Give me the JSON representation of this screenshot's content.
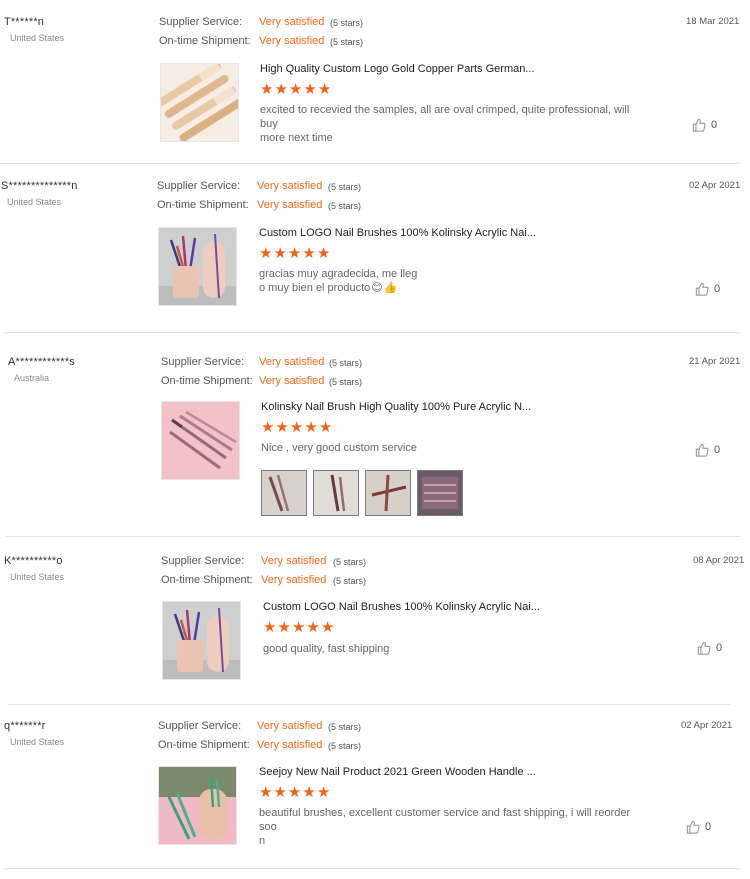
{
  "labels": {
    "supplier_service": "Supplier Service:",
    "on_time_shipment": "On-time Shipment:"
  },
  "colors": {
    "accent": "#f16a1a",
    "star": "#f5631a",
    "divider": "#e2e2e2",
    "muted_text": "#8a8a8a"
  },
  "reviews": [
    {
      "name": "T******n",
      "country": "United States",
      "supplier_rating": "Very satisfied",
      "supplier_stars": "(5 stars)",
      "shipment_rating": "Very satisfied",
      "shipment_stars": "(5 stars)",
      "date": "18 Mar 2021",
      "product_title": "High Quality Custom Logo Gold Copper Parts German...",
      "stars": 5,
      "comment_lines": [
        "excited to recevied the samples, all are oval crimped, quite professional, will buy",
        "more next time"
      ],
      "helpful_count": "0",
      "thumb_icon": "gold-brush-set-photo"
    },
    {
      "name": "S**************n",
      "country": "United States",
      "supplier_rating": "Very satisfied",
      "supplier_stars": "(5 stars)",
      "shipment_rating": "Very satisfied",
      "shipment_stars": "(5 stars)",
      "date": "02 Apr 2021",
      "product_title": "Custom LOGO Nail Brushes 100% Kolinsky Acrylic Nai...",
      "stars": 5,
      "comment_lines": [
        "gracias muy agradecida, me lleg",
        "o muy bien el producto"
      ],
      "emojis": [
        "😊",
        "👍"
      ],
      "helpful_count": "0",
      "thumb_icon": "brush-cup-photo"
    },
    {
      "name": "A************s",
      "country": "Australia",
      "supplier_rating": "Very satisfied",
      "supplier_stars": "(5 stars)",
      "shipment_rating": "Very satisfied",
      "shipment_stars": "(5 stars)",
      "date": "21 Apr 2021",
      "product_title": "Kolinsky Nail Brush High Quality 100% Pure Acrylic N...",
      "stars": 5,
      "comment_lines": [
        "Nice , very good custom service"
      ],
      "helpful_count": "0",
      "thumb_icon": "pink-brushes-photo",
      "review_photos": [
        "brush-photo-1",
        "brush-photo-2",
        "brush-photo-3",
        "brush-box-photo"
      ]
    },
    {
      "name": "K**********o",
      "country": "United States",
      "supplier_rating": "Very satisfied",
      "supplier_stars": "(5 stars)",
      "shipment_rating": "Very satisfied",
      "shipment_stars": "(5 stars)",
      "date": "08 Apr 2021",
      "product_title": "Custom LOGO Nail Brushes 100% Kolinsky Acrylic Nai...",
      "stars": 5,
      "comment_lines": [
        "good quality, fast shipping"
      ],
      "helpful_count": "0",
      "thumb_icon": "brush-cup-photo"
    },
    {
      "name": "q*******r",
      "country": "United States",
      "supplier_rating": "Very satisfied",
      "supplier_stars": "(5 stars)",
      "shipment_rating": "Very satisfied",
      "shipment_stars": "(5 stars)",
      "date": "02 Apr 2021",
      "product_title": "Seejoy New Nail Product 2021 Green Wooden Handle ...",
      "stars": 5,
      "comment_lines": [
        "beautiful brushes, excellent customer service and fast shipping, i will reorder soo",
        "n"
      ],
      "helpful_count": "0",
      "thumb_icon": "green-brushes-photo"
    }
  ]
}
